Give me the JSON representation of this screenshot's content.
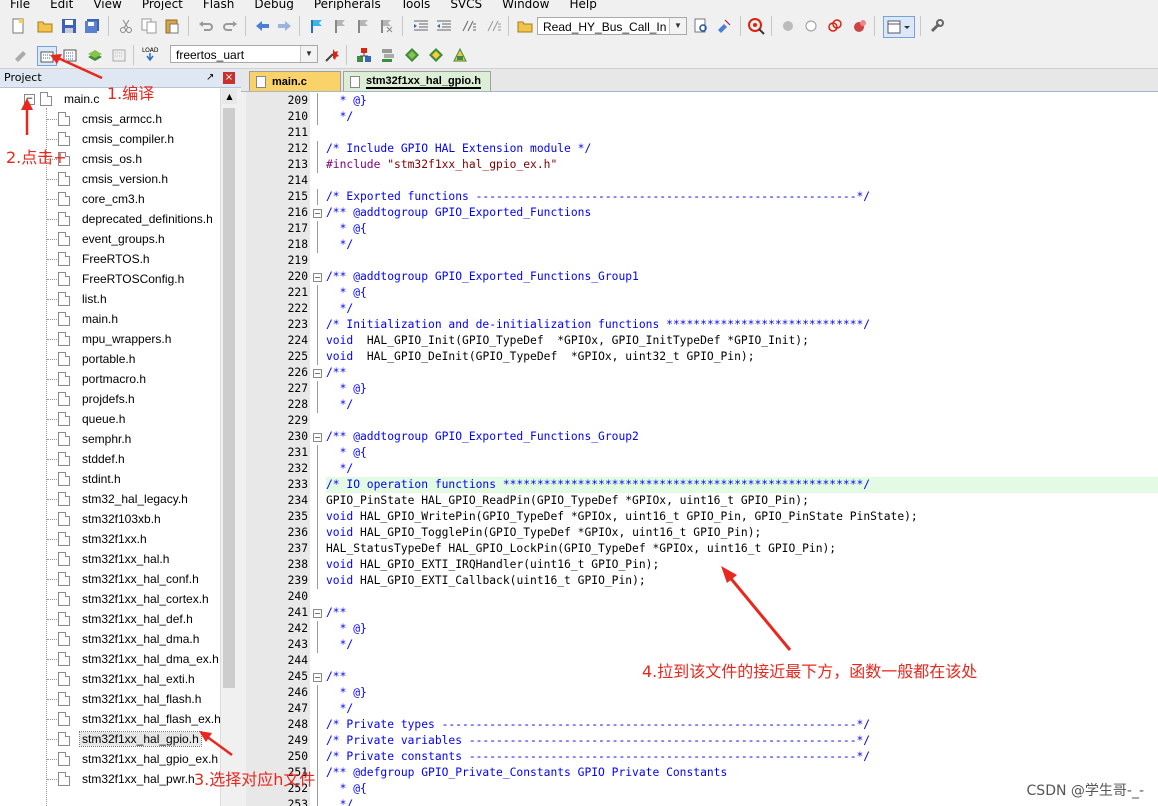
{
  "menu": [
    "File",
    "Edit",
    "View",
    "Project",
    "Flash",
    "Debug",
    "Peripherals",
    "Tools",
    "SVCS",
    "Window",
    "Help"
  ],
  "toolbar": {
    "function_combo": "Read_HY_Bus_Call_In",
    "target_combo": "freertos_uart",
    "icons_row1": [
      "new-file-icon",
      "open-folder-icon",
      "save-icon",
      "save-all-icon",
      "cut-icon",
      "copy-icon",
      "paste-icon",
      "undo-icon",
      "redo-icon",
      "back-arrow-icon",
      "forward-arrow-icon",
      "bookmark-icon",
      "bookmark-prev-icon",
      "bookmark-next-icon",
      "bookmark-clear-icon",
      "indent-icon",
      "unindent-icon",
      "comment-icon",
      "uncomment-icon",
      "find-in-files-icon",
      "find-icon",
      "debug-start-icon",
      "breakpoint-icon",
      "breakpoint-disable-icon",
      "breakpoint-kill-icon",
      "breakpoint-all-icon",
      "window-layout-icon",
      "settings-wrench-icon"
    ],
    "icons_row2": [
      "translate-icon",
      "build-icon",
      "rebuild-icon",
      "batch-build-icon",
      "stop-build-icon",
      "download-load-icon",
      "target-options-icon",
      "file-extensions-icon",
      "manage-env-icon",
      "pack-installer-icon",
      "select-packs-icon"
    ]
  },
  "project_panel": {
    "title": "Project",
    "pin": "ȧ",
    "close": "×",
    "root_file": "main.c",
    "files": [
      "cmsis_armcc.h",
      "cmsis_compiler.h",
      "cmsis_os.h",
      "cmsis_version.h",
      "core_cm3.h",
      "deprecated_definitions.h",
      "event_groups.h",
      "FreeRTOS.h",
      "FreeRTOSConfig.h",
      "list.h",
      "main.h",
      "mpu_wrappers.h",
      "portable.h",
      "portmacro.h",
      "projdefs.h",
      "queue.h",
      "semphr.h",
      "stddef.h",
      "stdint.h",
      "stm32_hal_legacy.h",
      "stm32f103xb.h",
      "stm32f1xx.h",
      "stm32f1xx_hal.h",
      "stm32f1xx_hal_conf.h",
      "stm32f1xx_hal_cortex.h",
      "stm32f1xx_hal_def.h",
      "stm32f1xx_hal_dma.h",
      "stm32f1xx_hal_dma_ex.h",
      "stm32f1xx_hal_exti.h",
      "stm32f1xx_hal_flash.h",
      "stm32f1xx_hal_flash_ex.h",
      "stm32f1xx_hal_gpio.h",
      "stm32f1xx_hal_gpio_ex.h",
      "stm32f1xx_hal_pwr.h"
    ],
    "selected_file": "stm32f1xx_hal_gpio.h"
  },
  "tabs": [
    {
      "label": "main.c",
      "active": false
    },
    {
      "label": "stm32f1xx_hal_gpio.h",
      "active": true
    }
  ],
  "editor": {
    "highlight_line": 233,
    "lines": [
      {
        "n": 209,
        "text": "  * @}"
      },
      {
        "n": 210,
        "text": "  */"
      },
      {
        "n": 211,
        "text": ""
      },
      {
        "n": 212,
        "text": "/* Include GPIO HAL Extension module */"
      },
      {
        "n": 213,
        "text": "#include \"stm32f1xx_hal_gpio_ex.h\""
      },
      {
        "n": 214,
        "text": ""
      },
      {
        "n": 215,
        "text": "/* Exported functions --------------------------------------------------------*/"
      },
      {
        "n": 216,
        "text": "/** @addtogroup GPIO_Exported_Functions"
      },
      {
        "n": 217,
        "text": "  * @{"
      },
      {
        "n": 218,
        "text": "  */"
      },
      {
        "n": 219,
        "text": ""
      },
      {
        "n": 220,
        "text": "/** @addtogroup GPIO_Exported_Functions_Group1"
      },
      {
        "n": 221,
        "text": "  * @{"
      },
      {
        "n": 222,
        "text": "  */"
      },
      {
        "n": 223,
        "text": "/* Initialization and de-initialization functions *****************************/"
      },
      {
        "n": 224,
        "text": "void  HAL_GPIO_Init(GPIO_TypeDef  *GPIOx, GPIO_InitTypeDef *GPIO_Init);"
      },
      {
        "n": 225,
        "text": "void  HAL_GPIO_DeInit(GPIO_TypeDef  *GPIOx, uint32_t GPIO_Pin);"
      },
      {
        "n": 226,
        "text": "/**"
      },
      {
        "n": 227,
        "text": "  * @}"
      },
      {
        "n": 228,
        "text": "  */"
      },
      {
        "n": 229,
        "text": ""
      },
      {
        "n": 230,
        "text": "/** @addtogroup GPIO_Exported_Functions_Group2"
      },
      {
        "n": 231,
        "text": "  * @{"
      },
      {
        "n": 232,
        "text": "  */"
      },
      {
        "n": 233,
        "text": "/* IO operation functions *****************************************************/"
      },
      {
        "n": 234,
        "text": "GPIO_PinState HAL_GPIO_ReadPin(GPIO_TypeDef *GPIOx, uint16_t GPIO_Pin);"
      },
      {
        "n": 235,
        "text": "void HAL_GPIO_WritePin(GPIO_TypeDef *GPIOx, uint16_t GPIO_Pin, GPIO_PinState PinState);"
      },
      {
        "n": 236,
        "text": "void HAL_GPIO_TogglePin(GPIO_TypeDef *GPIOx, uint16_t GPIO_Pin);"
      },
      {
        "n": 237,
        "text": "HAL_StatusTypeDef HAL_GPIO_LockPin(GPIO_TypeDef *GPIOx, uint16_t GPIO_Pin);"
      },
      {
        "n": 238,
        "text": "void HAL_GPIO_EXTI_IRQHandler(uint16_t GPIO_Pin);"
      },
      {
        "n": 239,
        "text": "void HAL_GPIO_EXTI_Callback(uint16_t GPIO_Pin);"
      },
      {
        "n": 240,
        "text": ""
      },
      {
        "n": 241,
        "text": "/**"
      },
      {
        "n": 242,
        "text": "  * @}"
      },
      {
        "n": 243,
        "text": "  */"
      },
      {
        "n": 244,
        "text": ""
      },
      {
        "n": 245,
        "text": "/**"
      },
      {
        "n": 246,
        "text": "  * @}"
      },
      {
        "n": 247,
        "text": "  */"
      },
      {
        "n": 248,
        "text": "/* Private types -------------------------------------------------------------*/"
      },
      {
        "n": 249,
        "text": "/* Private variables ---------------------------------------------------------*/"
      },
      {
        "n": 250,
        "text": "/* Private constants ---------------------------------------------------------*/"
      },
      {
        "n": 251,
        "text": "/** @defgroup GPIO_Private_Constants GPIO Private Constants"
      },
      {
        "n": 252,
        "text": "  * @{"
      },
      {
        "n": 253,
        "text": "  */"
      }
    ]
  },
  "annotations": {
    "step1": "1.编译",
    "step2": "2.点击+",
    "step3": "3.选择对应h文件",
    "step4": "4.拉到该文件的接近最下方，函数一般都在该处"
  },
  "watermark": "CSDN @学生哥-_-",
  "colors": {
    "comment": "#0000ff",
    "keyword": "#0000ff",
    "preprocessor": "#800080",
    "string": "#800000",
    "annotation": "#e8281e",
    "line_highlight": "#e2fbe2"
  }
}
